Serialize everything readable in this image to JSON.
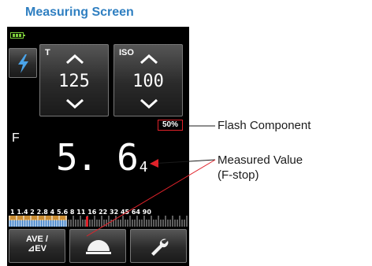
{
  "title": "Measuring Screen",
  "colors": {
    "accent": "#2f7fc1",
    "callout_line": "#e0222a",
    "battery": "#7fd13b"
  },
  "screen": {
    "status": {
      "battery_icon": "battery-icon"
    },
    "flash_mode_icon": "lightning-icon",
    "t_panel": {
      "label": "T",
      "value": "125"
    },
    "iso_panel": {
      "label": "ISO",
      "value": "100"
    },
    "flash_percentage": "50%",
    "f_label": "F",
    "measured_value": {
      "main": "5. 6",
      "decimal": "4"
    },
    "scale_labels": "1 1.4 2 2.8 4 5.6 8 11 16 22 32 45 64 90",
    "bottom_buttons": {
      "ave_label_line1": "AVE /",
      "ave_label_line2": "⊿EV",
      "dome_icon": "dome-icon",
      "tool_icon": "wrench-icon"
    }
  },
  "callouts": {
    "flash_component": "Flash Component",
    "measured_value_line1": "Measured Value",
    "measured_value_line2": "(F-stop)"
  }
}
